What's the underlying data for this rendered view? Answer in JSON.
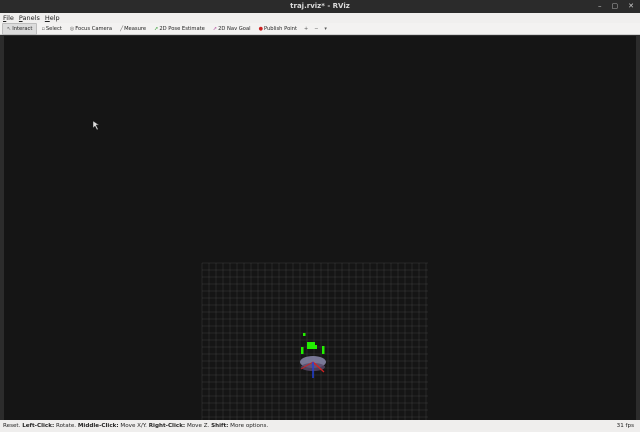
{
  "window": {
    "title": "traj.rviz* - RViz",
    "controls": [
      "–",
      "▢",
      "✕"
    ]
  },
  "menu": [
    {
      "label": "File",
      "mnemonic": "F",
      "rest": "ile"
    },
    {
      "label": "Panels",
      "mnemonic": "P",
      "rest": "anels"
    },
    {
      "label": "Help",
      "mnemonic": "H",
      "rest": "elp"
    }
  ],
  "toolbar": {
    "interact": "Interact",
    "select": "Select",
    "focus_camera": "Focus Camera",
    "measure": "Measure",
    "pose_estimate": "2D Pose Estimate",
    "nav_goal": "2D Nav Goal",
    "publish_point": "Publish Point",
    "add_tool": "+",
    "remove_tool": "−",
    "options": "▾"
  },
  "status": {
    "reset": "Reset.",
    "left_click_key": "Left-Click:",
    "left_click_val": "Rotate.",
    "middle_click_key": "Middle-Click:",
    "middle_click_val": "Move X/Y.",
    "right_click_key": "Right-Click:",
    "right_click_val": "Move Z.",
    "shift_key": "Shift:",
    "shift_val": "More options.",
    "fps": "31 fps"
  },
  "colors": {
    "viewport_bg": "#151515",
    "grid": "#5a5a5a",
    "points": "#22ee00",
    "robot": "#8888aa"
  }
}
